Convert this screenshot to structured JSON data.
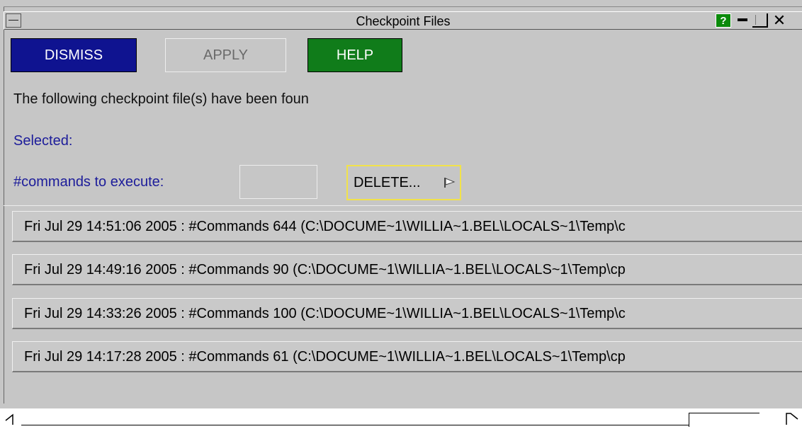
{
  "window": {
    "title": "Checkpoint Files",
    "help_glyph": "?"
  },
  "toolbar": {
    "dismiss_label": "DISMISS",
    "apply_label": "APPLY",
    "help_label": "HELP"
  },
  "message": "The following checkpoint file(s) have been foun",
  "selected_label": "Selected:",
  "commands": {
    "label": "#commands to execute:",
    "value": ""
  },
  "delete": {
    "label": "DELETE..."
  },
  "files": [
    {
      "label": "Fri Jul 29 14:51:06 2005 : #Commands 644  (C:\\DOCUME~1\\WILLIA~1.BEL\\LOCALS~1\\Temp\\c"
    },
    {
      "label": "Fri Jul 29 14:49:16 2005 : #Commands 90  (C:\\DOCUME~1\\WILLIA~1.BEL\\LOCALS~1\\Temp\\cp"
    },
    {
      "label": "Fri Jul 29 14:33:26 2005 : #Commands 100  (C:\\DOCUME~1\\WILLIA~1.BEL\\LOCALS~1\\Temp\\c"
    },
    {
      "label": "Fri Jul 29 14:17:28 2005 : #Commands 61  (C:\\DOCUME~1\\WILLIA~1.BEL\\LOCALS~1\\Temp\\cp"
    }
  ],
  "colors": {
    "dismiss": "#0f1390",
    "help": "#107c1a",
    "label_blue": "#1c1c9a",
    "delete_outline": "#f1e24a"
  }
}
